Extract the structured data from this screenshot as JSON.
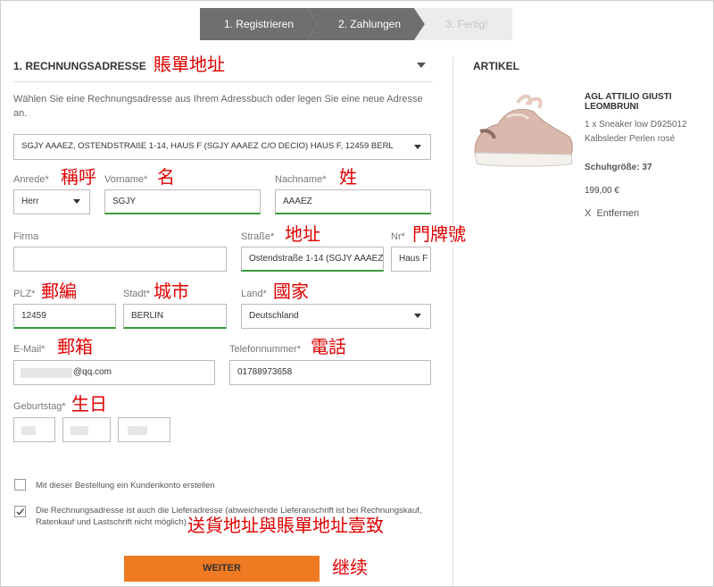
{
  "steps": [
    "1. Registrieren",
    "2. Zahlungen",
    "3. Fertig!"
  ],
  "billing": {
    "title": "1. RECHNUNGSADRESSE",
    "intro": "Wählen Sie eine Rechnungsadresse aus Ihrem Adressbuch oder legen Sie eine neue Adresse an.",
    "address_select": "SGJY AAAEZ, OSTENDSTRAßE 1-14, HAUS F   (SGJY AAAEZ C/O DECIO)   HAUS F, 12459 BERL",
    "salutation_label": "Anrede*",
    "salutation_value": "Herr",
    "firstname_label": "Vorname*",
    "firstname_value": "SGJY",
    "lastname_label": "Nachname*",
    "lastname_value": "AAAEZ",
    "company_label": "Firma",
    "company_value": "",
    "street_label": "Straße*",
    "street_value": "Ostendstraße 1-14   (SGJY AAAEZ",
    "number_label": "Nr*",
    "number_value": "Haus F",
    "zip_label": "PLZ*",
    "zip_value": "12459",
    "city_label": "Stadt*",
    "city_value": "BERLIN",
    "country_label": "Land*",
    "country_value": "Deutschland",
    "email_label": "E-Mail*",
    "email_value": "@qq.com",
    "phone_label": "Telefonnummer*",
    "phone_value": "01788973658",
    "birthday_label": "Geburtstag*",
    "create_account_label": "Mit dieser Bestellung ein Kundenkonto erstellen",
    "same_address_label": "Die Rechnungsadresse ist auch die Lieferadresse (abweichende Lieferanschrift ist bei Rechnungskauf, Ratenkauf und Lastschrift nicht möglich)",
    "same_address_checked": true,
    "continue_button": "WEITER"
  },
  "article": {
    "title": "ARTIKEL",
    "name": "AGL ATTILIO GIUSTI LEOMBRUNI",
    "desc_line1": "1 x Sneaker low D925012",
    "desc_line2": "Kalbsleder Perlen rosé",
    "size": "Schuhgröße: 37",
    "price": "199,00 €",
    "remove": "X  Entfernen"
  },
  "annotations": {
    "billing_address": "賬單地址",
    "salutation": "稱呼",
    "first_name": "名",
    "last_name": "姓",
    "street": "地址",
    "house_number": "門牌號",
    "zip": "郵編",
    "city": "城市",
    "country": "國家",
    "email": "郵箱",
    "phone": "電話",
    "birthday": "生日",
    "same_address": "送貨地址與賬單地址壹致",
    "continue": "继续"
  },
  "colors": {
    "accent": "#f07a21",
    "step_active": "#6f6f6f",
    "step_inactive": "#ececec",
    "valid": "#3a9a3a",
    "annotation": "#e00000"
  }
}
